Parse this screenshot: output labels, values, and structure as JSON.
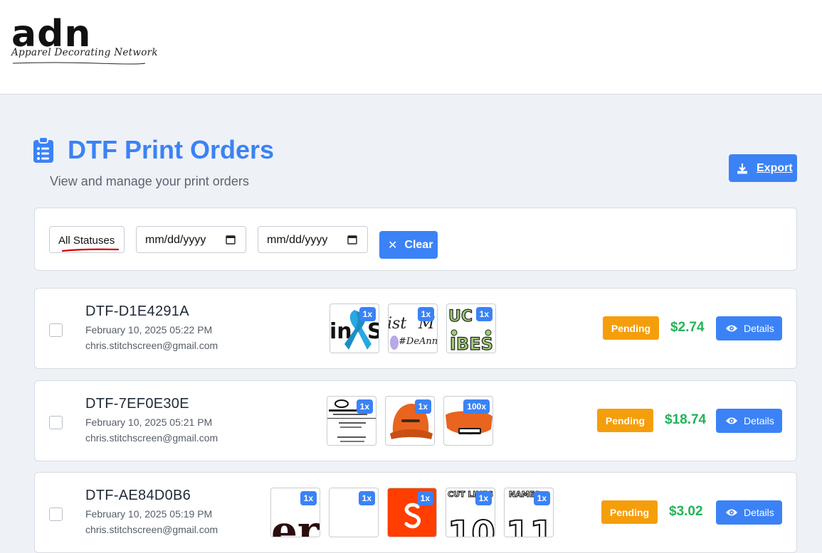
{
  "brand": {
    "logo_mark": "adn",
    "tagline": "Apparel Decorating Network"
  },
  "page": {
    "title": "DTF Print Orders",
    "subtitle": "View and manage your print orders"
  },
  "toolbar": {
    "export_label": "Export"
  },
  "filters": {
    "status_value": "All Statuses",
    "date_from_placeholder": "mm/dd/yyyy",
    "date_to_placeholder": "mm/dd/yyyy",
    "clear_label": "Clear"
  },
  "colors": {
    "accent": "#3b82f6",
    "pending": "#f59e0b",
    "price": "#22b357",
    "annotation": "#d40000"
  },
  "orders": [
    {
      "id": "DTF-D1E4291A",
      "date": "February 10, 2025 05:22 PM",
      "email": "chris.stitchscreen@gmail.com",
      "status": "Pending",
      "price": "$2.74",
      "details_label": "Details",
      "items": [
        {
          "qty": "1x",
          "icon": "awareness-ribbon-design"
        },
        {
          "qty": "1x",
          "icon": "script-text-design"
        },
        {
          "qty": "1x",
          "icon": "green-lettering-design"
        }
      ]
    },
    {
      "id": "DTF-7EF0E30E",
      "date": "February 10, 2025 05:21 PM",
      "email": "chris.stitchscreen@gmail.com",
      "status": "Pending",
      "price": "$18.74",
      "details_label": "Details",
      "items": [
        {
          "qty": "1x",
          "icon": "business-card-design"
        },
        {
          "qty": "1x",
          "icon": "orange-cap-design"
        },
        {
          "qty": "100x",
          "icon": "orange-cap-brim-design"
        }
      ]
    },
    {
      "id": "DTF-AE84D0B6",
      "date": "February 10, 2025 05:19 PM",
      "email": "chris.stitchscreen@gmail.com",
      "status": "Pending",
      "price": "$3.02",
      "details_label": "Details",
      "items": [
        {
          "qty": "1x",
          "icon": "dark-lettering-design"
        },
        {
          "qty": "1x",
          "icon": "blank-design"
        },
        {
          "qty": "1x",
          "icon": "svelte-logo-design"
        },
        {
          "qty": "1x",
          "icon": "number-10-design"
        },
        {
          "qty": "1x",
          "icon": "number-11-design"
        }
      ]
    }
  ]
}
